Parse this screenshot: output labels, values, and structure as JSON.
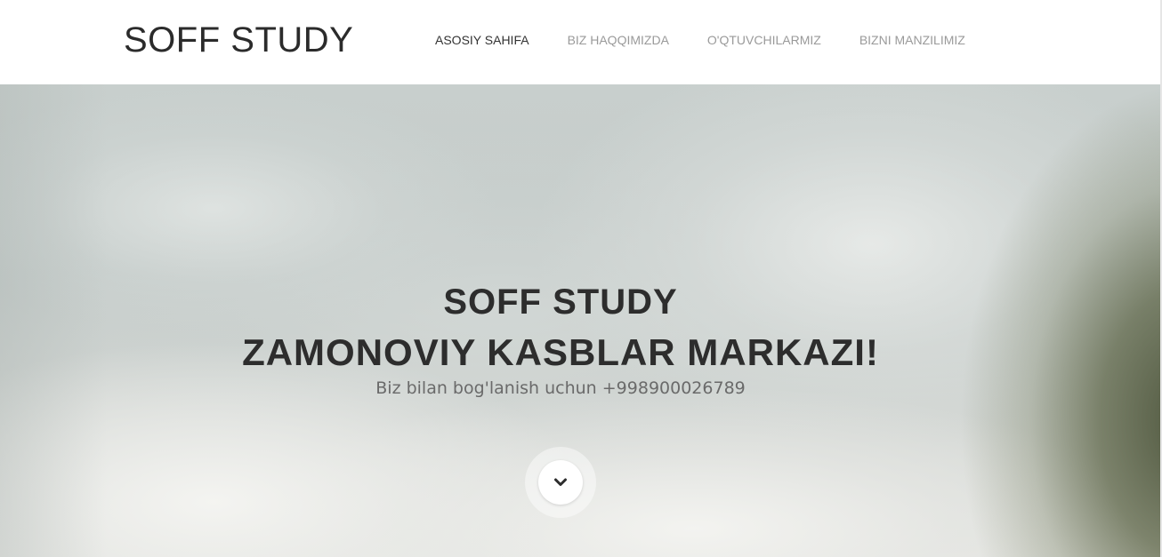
{
  "navbar": {
    "brand": "SOFF STUDY",
    "items": [
      {
        "label": "ASOSIY SAHIFA",
        "active": true
      },
      {
        "label": "BIZ HAQQIMIZDA",
        "active": false
      },
      {
        "label": "O'QTUVCHILARMIZ",
        "active": false
      },
      {
        "label": "BIZNI MANZILIMIZ",
        "active": false
      }
    ]
  },
  "hero": {
    "title_line_1": "SOFF STUDY",
    "title_line_2": "ZAMONOVIY KASBLAR MARKAZI!",
    "subtitle": "Biz bilan bog'lanish uchun +998900026789",
    "scroll_icon": "chevron-down-icon"
  },
  "colors": {
    "text_dark": "#2d2d2d",
    "nav_muted": "#9a9a9a",
    "nav_active": "#333333",
    "subtitle": "#6a6a6a"
  }
}
